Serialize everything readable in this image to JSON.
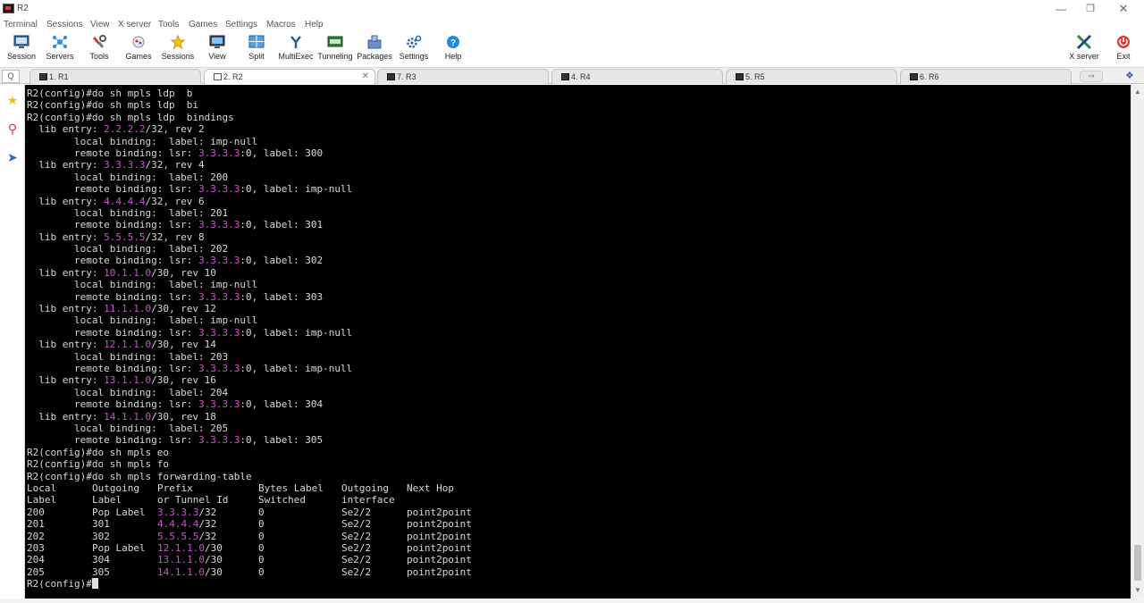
{
  "window": {
    "title": "R2"
  },
  "menu": [
    "Terminal",
    "Sessions",
    "View",
    "X server",
    "Tools",
    "Games",
    "Settings",
    "Macros",
    "Help"
  ],
  "toolbar": {
    "left": [
      {
        "label": "Session",
        "icon": "session-icon"
      },
      {
        "label": "Servers",
        "icon": "servers-icon"
      },
      {
        "label": "Tools",
        "icon": "tools-icon"
      },
      {
        "label": "Games",
        "icon": "games-icon"
      },
      {
        "label": "Sessions",
        "icon": "star-icon"
      },
      {
        "label": "View",
        "icon": "view-icon"
      },
      {
        "label": "Split",
        "icon": "split-icon"
      },
      {
        "label": "MultiExec",
        "icon": "multiexec-icon"
      },
      {
        "label": "Tunneling",
        "icon": "tunneling-icon"
      },
      {
        "label": "Packages",
        "icon": "packages-icon"
      },
      {
        "label": "Settings",
        "icon": "gear-icon"
      },
      {
        "label": "Help",
        "icon": "help-icon"
      }
    ],
    "right": [
      {
        "label": "X server",
        "icon": "x-server-icon"
      },
      {
        "label": "Exit",
        "icon": "power-icon"
      }
    ]
  },
  "tabs": [
    {
      "label": "1. R1",
      "active": false
    },
    {
      "label": "2. R2",
      "active": true
    },
    {
      "label": "7. R3",
      "active": false
    },
    {
      "label": "4. R4",
      "active": false
    },
    {
      "label": "5. R5",
      "active": false
    },
    {
      "label": "6. R6",
      "active": false
    }
  ],
  "colors": {
    "terminal_bg": "#000000",
    "terminal_fg": "#d8d8d8",
    "ip_highlight": "#d04fd0",
    "accent": "#1e88e5"
  },
  "terminal": {
    "commands_top": [
      "R2(config)#do sh mpls ldp  b",
      "R2(config)#do sh mpls ldp  bi",
      "R2(config)#do sh mpls ldp  bindings"
    ],
    "bindings": [
      {
        "prefix": "2.2.2.2",
        "mask": "/32",
        "rev": "2",
        "local": "imp-null",
        "lsr": "3.3.3.3",
        "remote": "300"
      },
      {
        "prefix": "3.3.3.3",
        "mask": "/32",
        "rev": "4",
        "local": "200",
        "lsr": "3.3.3.3",
        "remote": "imp-null"
      },
      {
        "prefix": "4.4.4.4",
        "mask": "/32",
        "rev": "6",
        "local": "201",
        "lsr": "3.3.3.3",
        "remote": "301"
      },
      {
        "prefix": "5.5.5.5",
        "mask": "/32",
        "rev": "8",
        "local": "202",
        "lsr": "3.3.3.3",
        "remote": "302"
      },
      {
        "prefix": "10.1.1.0",
        "mask": "/30",
        "rev": "10",
        "local": "imp-null",
        "lsr": "3.3.3.3",
        "remote": "303"
      },
      {
        "prefix": "11.1.1.0",
        "mask": "/30",
        "rev": "12",
        "local": "imp-null",
        "lsr": "3.3.3.3",
        "remote": "imp-null"
      },
      {
        "prefix": "12.1.1.0",
        "mask": "/30",
        "rev": "14",
        "local": "203",
        "lsr": "3.3.3.3",
        "remote": "imp-null"
      },
      {
        "prefix": "13.1.1.0",
        "mask": "/30",
        "rev": "16",
        "local": "204",
        "lsr": "3.3.3.3",
        "remote": "304"
      },
      {
        "prefix": "14.1.1.0",
        "mask": "/30",
        "rev": "18",
        "local": "205",
        "lsr": "3.3.3.3",
        "remote": "305"
      }
    ],
    "commands_mid": [
      "R2(config)#do sh mpls eo",
      "R2(config)#do sh mpls fo",
      "R2(config)#do sh mpls forwarding-table"
    ],
    "fwd_header1": [
      "Local",
      "Outgoing",
      "Prefix",
      "Bytes Label",
      "Outgoing",
      "Next Hop"
    ],
    "fwd_header2": [
      "Label",
      "Label",
      "or Tunnel Id",
      "Switched",
      "interface",
      ""
    ],
    "fwd_rows": [
      {
        "local": "200",
        "out": "Pop Label",
        "prefix": "3.3.3.3",
        "mask": "/32",
        "bytes": "0",
        "intf": "Se2/2",
        "nh": "point2point"
      },
      {
        "local": "201",
        "out": "301",
        "prefix": "4.4.4.4",
        "mask": "/32",
        "bytes": "0",
        "intf": "Se2/2",
        "nh": "point2point"
      },
      {
        "local": "202",
        "out": "302",
        "prefix": "5.5.5.5",
        "mask": "/32",
        "bytes": "0",
        "intf": "Se2/2",
        "nh": "point2point"
      },
      {
        "local": "203",
        "out": "Pop Label",
        "prefix": "12.1.1.0",
        "mask": "/30",
        "bytes": "0",
        "intf": "Se2/2",
        "nh": "point2point"
      },
      {
        "local": "204",
        "out": "304",
        "prefix": "13.1.1.0",
        "mask": "/30",
        "bytes": "0",
        "intf": "Se2/2",
        "nh": "point2point"
      },
      {
        "local": "205",
        "out": "305",
        "prefix": "14.1.1.0",
        "mask": "/30",
        "bytes": "0",
        "intf": "Se2/2",
        "nh": "point2point"
      }
    ],
    "prompt": "R2(config)#"
  }
}
